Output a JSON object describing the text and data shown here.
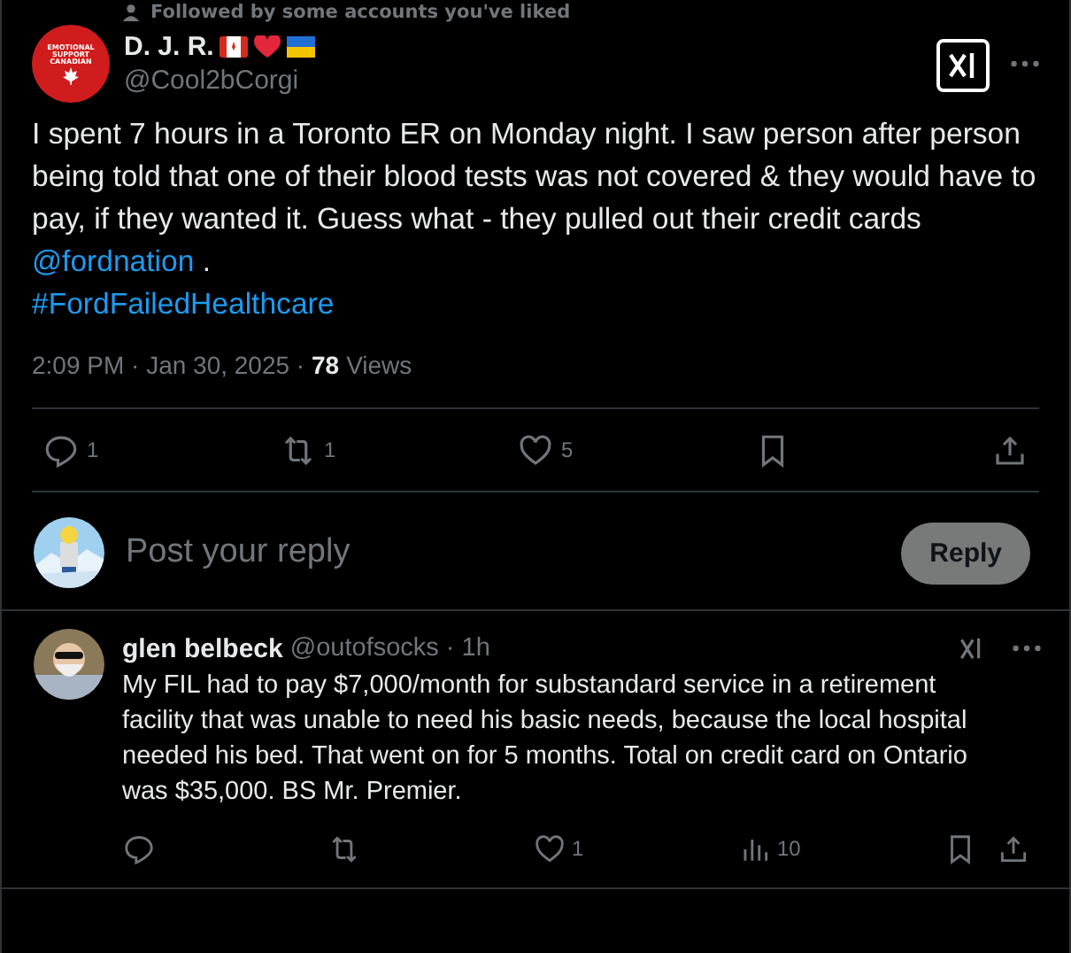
{
  "context": {
    "text": "Followed by some accounts you've liked"
  },
  "tweet": {
    "name": "D. J. R.",
    "handle": "@Cool2bCorgi",
    "avatar_text": [
      "EMOTIONAL",
      "SUPPORT",
      "CANADIAN"
    ],
    "body": [
      {
        "kind": "text",
        "text": "I spent 7 hours in a Toronto ER on Monday night. I saw person after person being told that one of their blood tests was not covered & they would have to pay, if they wanted it. Guess what - they pulled out their credit cards "
      },
      {
        "kind": "link",
        "text": "@fordnation"
      },
      {
        "kind": "text",
        "text": " ."
      },
      {
        "kind": "break"
      },
      {
        "kind": "link",
        "text": "#FordFailedHealthcare"
      }
    ],
    "meta": "2:09 PM · Jan 30, 2025 · ",
    "views": "78",
    "views_label": "Views",
    "actions": [
      {
        "kind": "reply",
        "count": "1"
      },
      {
        "kind": "repost",
        "count": "1"
      },
      {
        "kind": "like",
        "count": "5"
      },
      {
        "kind": "bookmark"
      },
      {
        "kind": "share"
      }
    ]
  },
  "composer": {
    "placeholder": "Post your reply",
    "button": "Reply"
  },
  "reply": {
    "name": "glen belbeck",
    "handle": "@outofsocks",
    "time": "· 1h",
    "text": "My FIL had to pay $7,000/month for substandard service in a retirement facility that was unable to need his basic needs, because the local hospital needed his bed.  That went on for 5 months.  Total on credit card on Ontario was $35,000.  BS Mr. Premier.",
    "actions": [
      {
        "kind": "reply"
      },
      {
        "kind": "repost"
      },
      {
        "kind": "like",
        "count": "1"
      },
      {
        "kind": "views",
        "count": "10"
      },
      {
        "kind": "bookmark"
      },
      {
        "kind": "share"
      }
    ]
  }
}
